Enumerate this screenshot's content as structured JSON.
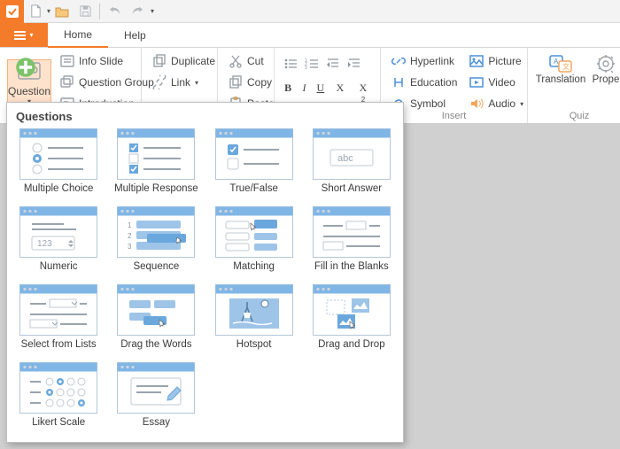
{
  "qat": {
    "new_caret": "▾",
    "redo_caret": "▾"
  },
  "tabs": {
    "home": "Home",
    "help": "Help"
  },
  "ribbon": {
    "question": "Question",
    "info_slide": "Info Slide",
    "question_group": "Question Group",
    "introduction": "Introduction",
    "duplicate": "Duplicate",
    "link": "Link",
    "cut": "Cut",
    "copy": "Copy",
    "paste": "Paste",
    "bold": "B",
    "italic": "I",
    "underline": "U",
    "sub": "X",
    "sup": "X",
    "hyperlink": "Hyperlink",
    "education": "Education",
    "symbol": "Symbol",
    "picture": "Picture",
    "video": "Video",
    "audio": "Audio",
    "translation": "Translation",
    "properties": "Prope",
    "group_insert": "Insert",
    "group_quiz": "Quiz"
  },
  "panel": {
    "title": "Questions",
    "items": [
      "Multiple Choice",
      "Multiple Response",
      "True/False",
      "Short Answer",
      "Numeric",
      "Sequence",
      "Matching",
      "Fill in the Blanks",
      "Select from Lists",
      "Drag the Words",
      "Hotspot",
      "Drag and Drop",
      "Likert Scale",
      "Essay"
    ]
  }
}
